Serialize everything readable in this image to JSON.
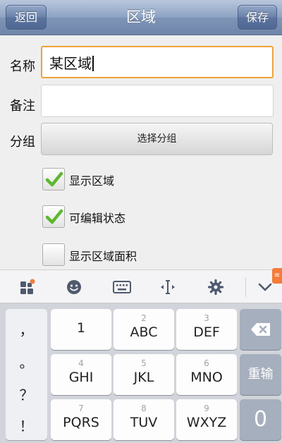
{
  "navbar": {
    "back_label": "返回",
    "title": "区域",
    "save_label": "保存"
  },
  "form": {
    "name_label": "名称",
    "name_value": "某区域",
    "note_label": "备注",
    "note_value": "",
    "group_label": "分组",
    "group_button_label": "选择分组",
    "checkboxes": [
      {
        "label": "显示区域",
        "checked": true
      },
      {
        "label": "可编辑状态",
        "checked": true
      },
      {
        "label": "显示区域面积",
        "checked": false
      }
    ]
  },
  "keyboard_toolbar": {
    "icons": [
      "apps-icon",
      "emoji-icon",
      "keyboard-icon",
      "cursor-icon",
      "settings-icon",
      "collapse-icon"
    ]
  },
  "keyboard": {
    "symbols": [
      "，",
      "。",
      "？",
      "！"
    ],
    "keys": [
      {
        "num": "",
        "letters": "1"
      },
      {
        "num": "2",
        "letters": "ABC"
      },
      {
        "num": "3",
        "letters": "DEF"
      },
      {
        "num": "4",
        "letters": "GHI"
      },
      {
        "num": "5",
        "letters": "JKL"
      },
      {
        "num": "6",
        "letters": "MNO"
      },
      {
        "num": "7",
        "letters": "PQRS"
      },
      {
        "num": "8",
        "letters": "TUV"
      },
      {
        "num": "9",
        "letters": "WXYZ"
      }
    ],
    "reinput_label": "重输",
    "zero_label": "0"
  },
  "colors": {
    "focus_border": "#f0a238",
    "check_green": "#5cb82e",
    "navbar": "#7f95b8"
  }
}
